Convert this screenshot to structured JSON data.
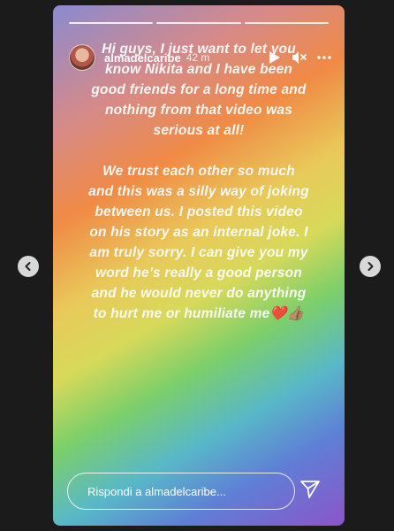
{
  "story": {
    "username": "almadelcaribe",
    "time": "42 m",
    "progress_segments": 3,
    "text_paragraphs": [
      "Hi guys, I just want to let you know Nikita and I have been good friends for a long time and nothing from that video was serious at all!",
      "We trust each other so much and this was a silly way of joking between us. I posted this video on his story as an internal joke. I am truly sorry. I can give you my word he’s really a good person and he would never do anything to hurt me or humiliate me❤️👍🏽"
    ]
  },
  "reply": {
    "placeholder": "Rispondi a almadelcaribe..."
  },
  "icons": {
    "play": "play-icon",
    "mute": "speaker-muted-icon",
    "more": "more-icon",
    "send": "send-icon",
    "prev": "chevron-left-icon",
    "next": "chevron-right-icon"
  }
}
